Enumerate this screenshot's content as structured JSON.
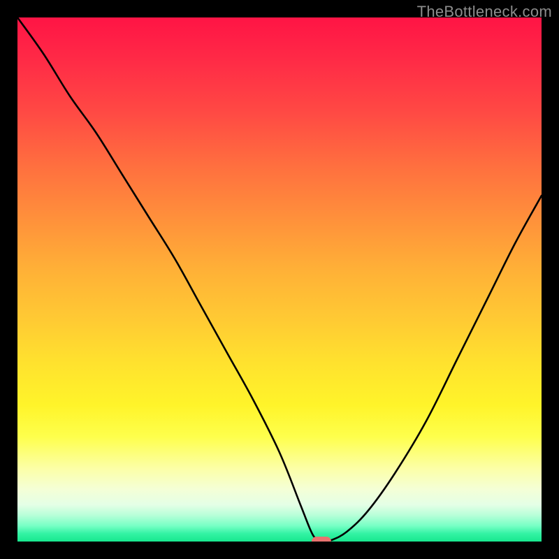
{
  "watermark": "TheBottleneck.com",
  "colors": {
    "background": "#000000",
    "curve": "#000000",
    "marker": "#e9726f",
    "watermark_text": "#8d8d8d"
  },
  "chart_data": {
    "type": "line",
    "title": "",
    "xlabel": "",
    "ylabel": "",
    "xlim": [
      0,
      100
    ],
    "ylim": [
      0,
      100
    ],
    "grid": false,
    "legend": false,
    "description": "Bottleneck curve showing mismatch percentage vs component balance. Left branch descends steeply from top-left; right branch rises toward upper-right. Minimum (zero bottleneck) near x≈58.",
    "series": [
      {
        "name": "left-branch",
        "x": [
          0,
          5,
          10,
          15,
          20,
          25,
          30,
          35,
          40,
          45,
          50,
          54,
          56,
          57,
          58
        ],
        "y": [
          100,
          93,
          85,
          78,
          70,
          62,
          54,
          45,
          36,
          27,
          17,
          7,
          2,
          0.5,
          0
        ]
      },
      {
        "name": "right-branch",
        "x": [
          58,
          60,
          63,
          67,
          72,
          78,
          84,
          90,
          95,
          100
        ],
        "y": [
          0,
          0.3,
          2,
          6,
          13,
          23,
          35,
          47,
          57,
          66
        ]
      }
    ],
    "marker": {
      "x": 58,
      "y": 0
    },
    "gradient_stops": [
      {
        "pos": 0,
        "color": "#ff1445"
      },
      {
        "pos": 0.5,
        "color": "#ffc033"
      },
      {
        "pos": 0.8,
        "color": "#feff4c"
      },
      {
        "pos": 1.0,
        "color": "#17e78e"
      }
    ]
  }
}
